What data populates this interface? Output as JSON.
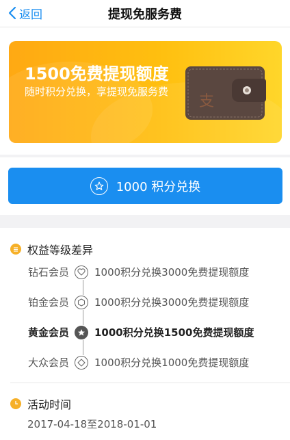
{
  "nav": {
    "back_label": "返回",
    "title": "提现免服务费"
  },
  "banner": {
    "title": "1500免费提现额度",
    "subtitle": "随时积分兑换，享提现免服务费"
  },
  "exchange_button": {
    "label": "1000 积分兑换"
  },
  "benefits": {
    "heading": "权益等级差异",
    "tiers": [
      {
        "name": "钻石会员",
        "desc": "1000积分兑换3000免费提现额度",
        "icon": "heart-icon",
        "active": false
      },
      {
        "name": "铂金会员",
        "desc": "1000积分兑换3000免费提现额度",
        "icon": "hexagon-icon",
        "active": false
      },
      {
        "name": "黄金会员",
        "desc": "1000积分兑换1500免费提现额度",
        "icon": "star-icon",
        "active": true
      },
      {
        "name": "大众会员",
        "desc": "1000积分兑换1000免费提现额度",
        "icon": "diamond-icon",
        "active": false
      }
    ]
  },
  "activity": {
    "heading": "活动时间",
    "period": "2017-04-18至2018-01-01"
  },
  "colors": {
    "accent": "#1a8ef0",
    "banner_orange": "#ffa913",
    "bullet": "#f6b028"
  }
}
